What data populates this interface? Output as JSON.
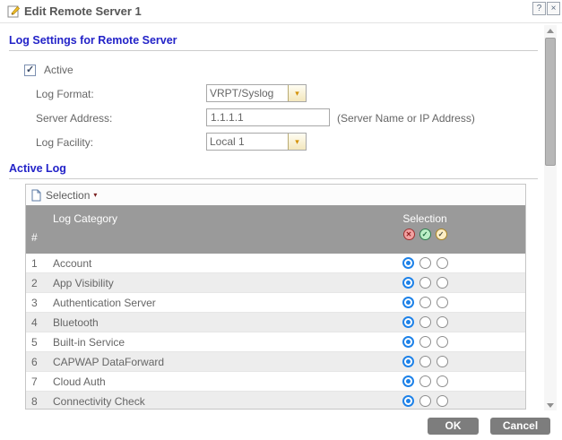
{
  "window": {
    "title": "Edit Remote Server 1",
    "help_button": "?",
    "close_button": "×"
  },
  "log_settings_section": {
    "heading": "Log Settings for Remote Server",
    "active": {
      "label": "Active",
      "checked": true,
      "check_glyph": "✓"
    },
    "log_format": {
      "label": "Log Format:",
      "value": "VRPT/Syslog",
      "dropdown_glyph": "▾"
    },
    "server_address": {
      "label": "Server Address:",
      "value": "1.1.1.1",
      "hint": "(Server Name or IP Address)"
    },
    "log_facility": {
      "label": "Log Facility:",
      "value": "Local 1",
      "dropdown_glyph": "▾"
    }
  },
  "active_log_section": {
    "heading": "Active Log",
    "toolbar": {
      "selection_menu": "Selection",
      "caret_glyph": "▾",
      "icon": "document-icon"
    },
    "table": {
      "headers": {
        "number": "#",
        "category": "Log Category",
        "selection": "Selection"
      },
      "selection_icons": [
        {
          "name": "red-cross-disable-icon",
          "glyph": "✕"
        },
        {
          "name": "green-check-enable-icon",
          "glyph": "✓"
        },
        {
          "name": "yellow-check-alert-icon",
          "glyph": "✓"
        }
      ],
      "rows": [
        {
          "num": "1",
          "category": "Account",
          "selected": 0
        },
        {
          "num": "2",
          "category": "App Visibility",
          "selected": 0
        },
        {
          "num": "3",
          "category": "Authentication Server",
          "selected": 0
        },
        {
          "num": "4",
          "category": "Bluetooth",
          "selected": 0
        },
        {
          "num": "5",
          "category": "Built-in Service",
          "selected": 0
        },
        {
          "num": "6",
          "category": "CAPWAP DataForward",
          "selected": 0
        },
        {
          "num": "7",
          "category": "Cloud Auth",
          "selected": 0
        },
        {
          "num": "8",
          "category": "Connectivity Check",
          "selected": 0
        }
      ]
    }
  },
  "footer": {
    "ok_button": "OK",
    "cancel_button": "Cancel"
  },
  "colors": {
    "heading_blue": "#2323c8",
    "table_header_bg": "#9a9a9a",
    "radio_selected_blue": "#1e82e8",
    "button_grey": "#7d7d7d"
  }
}
